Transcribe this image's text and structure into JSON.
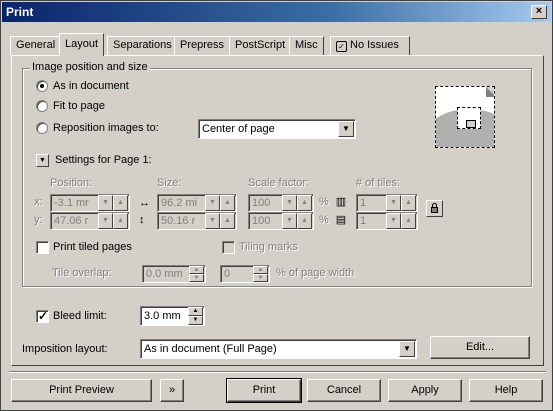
{
  "window": {
    "title": "Print",
    "close_glyph": "×"
  },
  "tabs": [
    {
      "label": "General"
    },
    {
      "label": "Layout"
    },
    {
      "label": "Separations"
    },
    {
      "label": "Prepress"
    },
    {
      "label": "PostScript"
    },
    {
      "label": "Misc"
    },
    {
      "label": "No Issues",
      "icon": "document-check-icon"
    }
  ],
  "image_group": {
    "label": "Image position and size",
    "options": [
      {
        "label": "As in document",
        "selected": true
      },
      {
        "label": "Fit to page",
        "selected": false
      },
      {
        "label": "Reposition images to:",
        "selected": false
      }
    ],
    "reposition_value": "Center of page",
    "settings_label": "Settings for Page 1:",
    "headers": {
      "position": "Position:",
      "size": "Size:",
      "scale": "Scale factor:",
      "tiles": "# of tiles:"
    },
    "x_label": "x:",
    "y_label": "y:",
    "pos_x": "-3.1 mr",
    "pos_y": "47.06 r",
    "size_w": "96.2 mi",
    "size_h": "50.16 r",
    "scale_x": "100",
    "scale_y": "100",
    "percent": "%",
    "tiles_x": "1",
    "tiles_y": "1",
    "print_tiled": "Print tiled pages",
    "tiling_marks": "Tiling marks",
    "tile_overlap_label": "Tile overlap:",
    "tile_overlap_value": "0.0 mm",
    "page_width_value": "0",
    "page_width_label": "% of page width"
  },
  "bleed": {
    "label": "Bleed limit:",
    "value": "3.0 mm",
    "checked": true
  },
  "imposition": {
    "label": "Imposition layout:",
    "value": "As in document (Full Page)",
    "edit": "Edit..."
  },
  "footer": {
    "preview": "Print Preview",
    "print": "Print",
    "cancel": "Cancel",
    "apply": "Apply",
    "help": "Help"
  },
  "glyphs": {
    "up": "▲",
    "down": "▼",
    "triangle": "▼",
    "expand": "»"
  }
}
